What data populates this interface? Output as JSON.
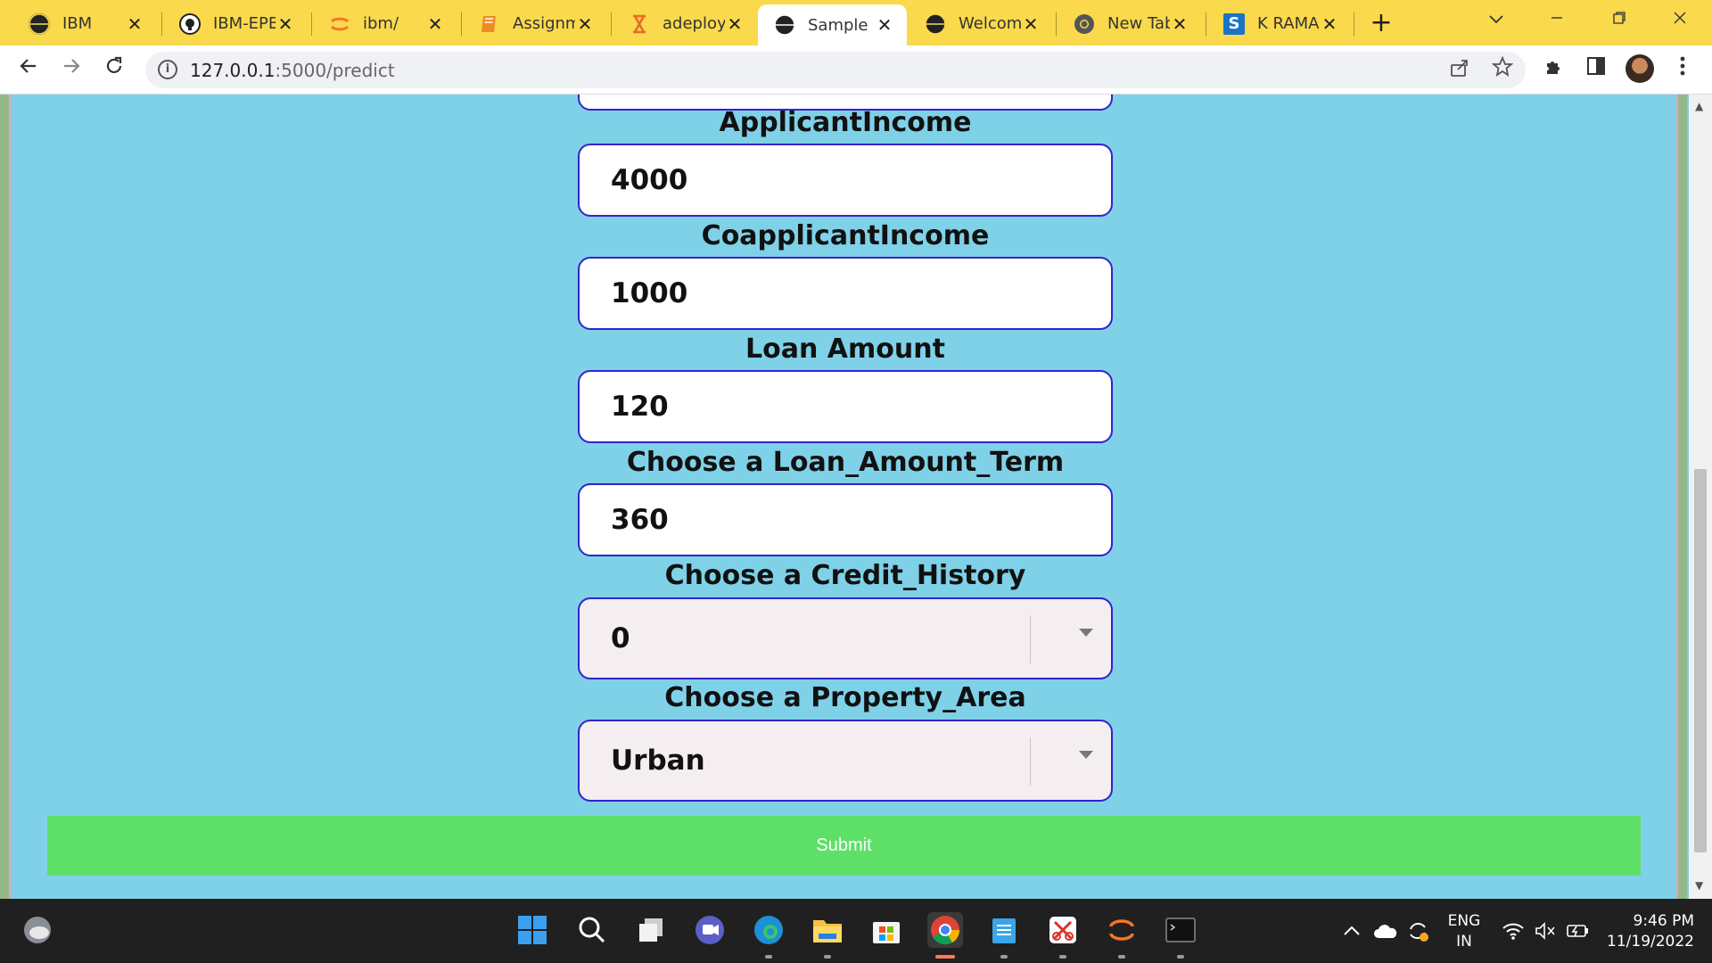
{
  "browser": {
    "tabs": [
      {
        "label": "IBM",
        "icon": "globe-icon",
        "close": "✕"
      },
      {
        "label": "IBM-EPBL",
        "icon": "github-icon",
        "close": "✕"
      },
      {
        "label": "ibm/",
        "icon": "jupyter-icon",
        "close": "✕"
      },
      {
        "label": "Assignm",
        "icon": "book-icon",
        "close": "✕"
      },
      {
        "label": "adeploy",
        "icon": "hourglass-icon",
        "close": "✕"
      },
      {
        "label": "Sample F",
        "icon": "globe-icon",
        "close": "✕"
      },
      {
        "label": "Welcome",
        "icon": "globe-icon",
        "close": "✕"
      },
      {
        "label": "New Tab",
        "icon": "chrome-icon",
        "close": "✕"
      },
      {
        "label": "K RAMAI",
        "icon": "s-logo-icon",
        "close": "✕"
      }
    ],
    "active_tab_index": 5,
    "new_tab": "+",
    "address": "127.0.0.1:5000/predict",
    "address_host": "127.0.0.1",
    "address_rest": ":5000/predict",
    "accent": "#fad94c"
  },
  "form": {
    "applicant_income_label": "ApplicantIncome",
    "applicant_income_value": "4000",
    "coapplicant_income_label": "CoapplicantIncome",
    "coapplicant_income_value": "1000",
    "loan_amount_label": "Loan Amount",
    "loan_amount_value": "120",
    "loan_term_label": "Choose a Loan_Amount_Term",
    "loan_term_value": "360",
    "credit_history_label": "Choose a Credit_History",
    "credit_history_value": "0",
    "property_area_label": "Choose a Property_Area",
    "property_area_value": "Urban",
    "submit_label": "Submit"
  },
  "colors": {
    "page_bg": "#7fd1e8",
    "input_border": "#3322cc",
    "submit_bg": "#5ee068"
  },
  "taskbar": {
    "lang_line1": "ENG",
    "lang_line2": "IN",
    "time": "9:46 PM",
    "date": "11/19/2022"
  }
}
